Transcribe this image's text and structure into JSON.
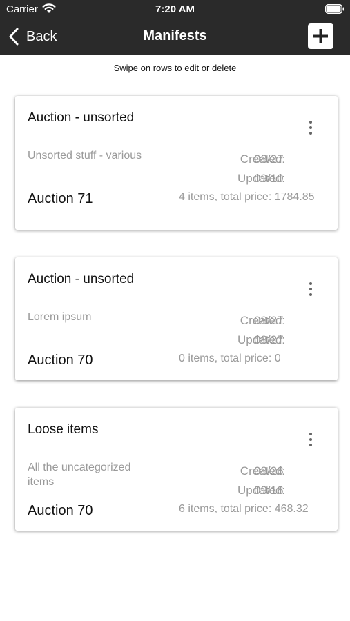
{
  "status_bar": {
    "carrier": "Carrier",
    "time": "7:20 AM"
  },
  "nav": {
    "back_label": "Back",
    "title": "Manifests"
  },
  "hint": "Swipe on rows to edit or delete",
  "labels": {
    "created": "Created:",
    "updated": "Updated:"
  },
  "manifests": [
    {
      "title": "Auction - unsorted",
      "description": "Unsorted stuff - various",
      "created": "08/27",
      "updated": "09/10",
      "auction": "Auction 71",
      "summary": "4 items, total price: 1784.85"
    },
    {
      "title": "Auction - unsorted",
      "description": "Lorem ipsum",
      "created": "08/27",
      "updated": "08/27",
      "auction": "Auction 70",
      "summary": "0 items, total price: 0"
    },
    {
      "title": "Loose items",
      "description": "All the uncategorized items",
      "created": "08/26",
      "updated": "09/16",
      "auction": "Auction 70",
      "summary": "6 items, total price: 468.32"
    }
  ]
}
